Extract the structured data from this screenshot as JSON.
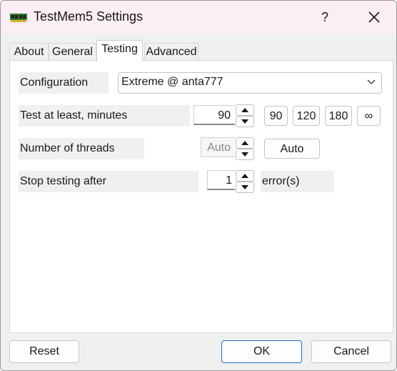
{
  "window": {
    "title": "TestMem5 Settings",
    "help_label": "?",
    "app_icon": "memory-chip-icon",
    "close_icon": "close-icon"
  },
  "tabs": [
    {
      "label": "About",
      "active": false
    },
    {
      "label": "General",
      "active": false
    },
    {
      "label": "Testing",
      "active": true
    },
    {
      "label": "Advanced",
      "active": false
    }
  ],
  "testing": {
    "configuration_label": "Configuration",
    "configuration_value": "Extreme @ anta777",
    "min_minutes_label": "Test at least, minutes",
    "min_minutes_value": "90",
    "presets": [
      "90",
      "120",
      "180",
      "∞"
    ],
    "threads_label": "Number of threads",
    "threads_value": "Auto",
    "threads_auto_button": "Auto",
    "stop_label": "Stop testing after",
    "stop_value": "1",
    "stop_unit": "error(s)"
  },
  "buttons": {
    "reset": "Reset",
    "ok": "OK",
    "cancel": "Cancel"
  },
  "colors": {
    "titlebar": "#fbeef5",
    "dialog_bg": "#f0f0f0",
    "accent": "#1c6fc6"
  }
}
